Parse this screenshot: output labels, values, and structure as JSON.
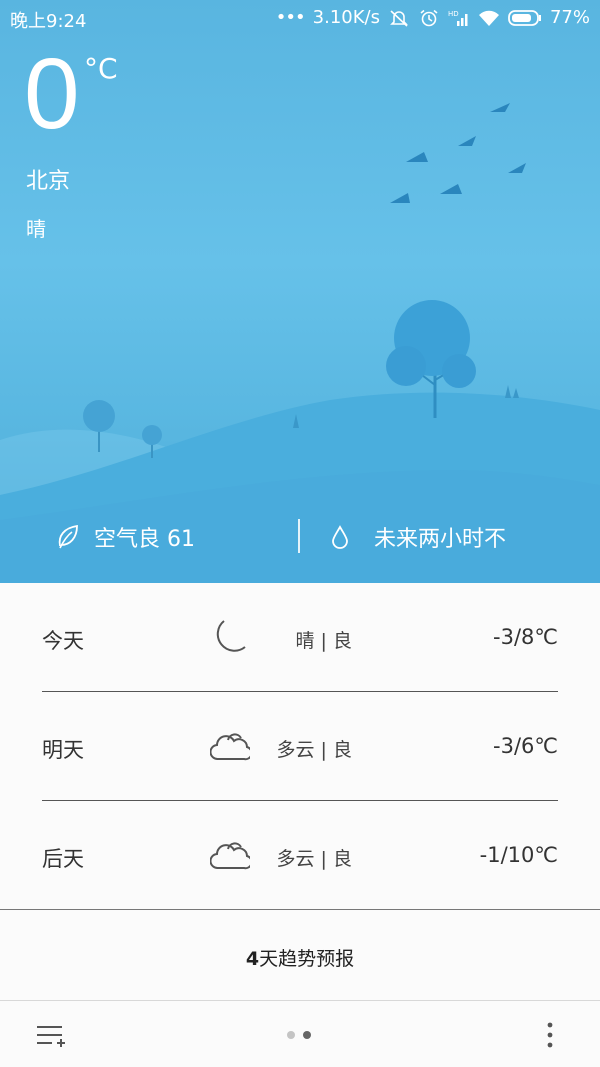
{
  "status_bar": {
    "time": "晚上9:24",
    "dots": "•••",
    "network_speed": "3.10K/s",
    "hd_label": "HD",
    "battery": "77%"
  },
  "current": {
    "temperature": "0",
    "unit": "°C",
    "city": "北京",
    "condition": "晴"
  },
  "info_strip": {
    "air_quality": "空气良 61",
    "rain_forecast": "未来两小时不"
  },
  "daily": [
    {
      "day": "今天",
      "icon": "moon-icon",
      "condition": "晴 | 良",
      "temp_range": "-3/8℃"
    },
    {
      "day": "明天",
      "icon": "cloud-icon",
      "condition": "多云 | 良",
      "temp_range": "-3/6℃"
    },
    {
      "day": "后天",
      "icon": "cloud-icon",
      "condition": "多云 | 良",
      "temp_range": "-1/10℃"
    }
  ],
  "forecast_link": {
    "prefix": "4",
    "label": "天趋势预报"
  },
  "colors": {
    "sky_top": "#59b5e0",
    "sky_bottom": "#3fa3d6",
    "list_bg": "#fbfbfb",
    "text_dark": "#333333"
  }
}
